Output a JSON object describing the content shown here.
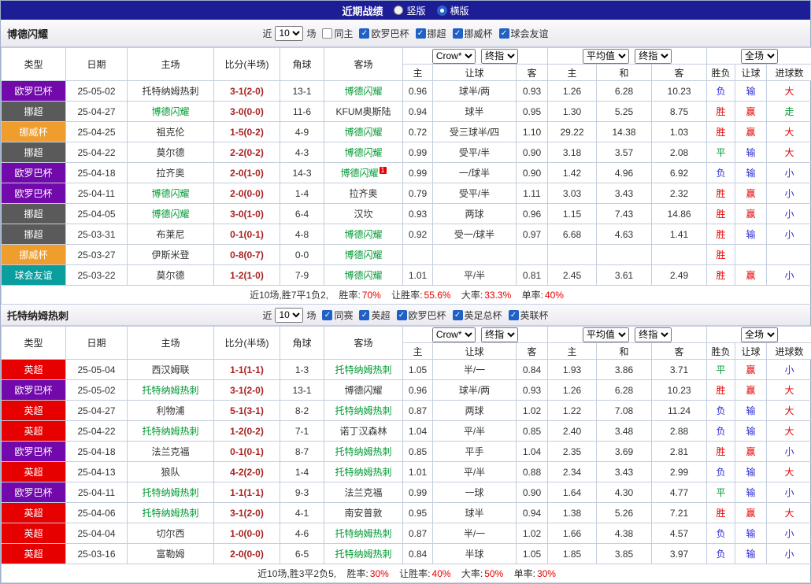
{
  "topbar": {
    "title": "近期战绩",
    "options": [
      {
        "label": "竖版",
        "selected": false
      },
      {
        "label": "横版",
        "selected": true
      }
    ]
  },
  "colors": {
    "league": {
      "欧罗巴杯": "#7109ab",
      "挪超": "#5a5a5a",
      "挪威杯": "#ef9d2c",
      "球会友谊": "#0a9e9e",
      "英超": "#e60000"
    },
    "result": {
      "胜": "#e60000",
      "平": "#009933",
      "负": "#2c2cd4",
      "赢": "#e60000",
      "走": "#009933",
      "输": "#2c2cd4",
      "大": "#e60000",
      "小": "#2c2cd4"
    }
  },
  "table_header": {
    "type": "类型",
    "date": "日期",
    "home": "主场",
    "score": "比分(半场)",
    "corner": "角球",
    "away": "客场",
    "bookmaker": "Crow*",
    "final_index_1": "终指",
    "average": "平均值",
    "final_index_2": "终指",
    "scope": "全场",
    "sub": [
      "主",
      "让球",
      "客",
      "主",
      "和",
      "客",
      "胜负",
      "让球",
      "进球数"
    ]
  },
  "sections": [
    {
      "team": "博德闪耀",
      "near_label": "近",
      "matches_value": "10",
      "matches_suffix": "场",
      "same_filter": {
        "label": "同主",
        "checked": false
      },
      "leagues": [
        {
          "label": "欧罗巴杯",
          "checked": true
        },
        {
          "label": "挪超",
          "checked": true
        },
        {
          "label": "挪威杯",
          "checked": true
        },
        {
          "label": "球会友谊",
          "checked": true
        }
      ],
      "rows": [
        {
          "league": "欧罗巴杯",
          "date": "25-05-02",
          "home": "托特纳姆热刺",
          "home_focus": false,
          "score": "3-1(2-0)",
          "corners": "13-1",
          "away": "博德闪耀",
          "away_focus": true,
          "odds": [
            "0.96",
            "球半/两",
            "0.93",
            "1.26",
            "6.28",
            "10.23"
          ],
          "results": [
            "负",
            "输",
            "大"
          ]
        },
        {
          "league": "挪超",
          "date": "25-04-27",
          "home": "博德闪耀",
          "home_focus": true,
          "score": "3-0(0-0)",
          "corners": "11-6",
          "away": "KFUM奥斯陆",
          "away_focus": false,
          "odds": [
            "0.94",
            "球半",
            "0.95",
            "1.30",
            "5.25",
            "8.75"
          ],
          "results": [
            "胜",
            "赢",
            "走"
          ]
        },
        {
          "league": "挪威杯",
          "date": "25-04-25",
          "home": "祖克伦",
          "home_focus": false,
          "score": "1-5(0-2)",
          "corners": "4-9",
          "away": "博德闪耀",
          "away_focus": true,
          "odds": [
            "0.72",
            "受三球半/四",
            "1.10",
            "29.22",
            "14.38",
            "1.03"
          ],
          "results": [
            "胜",
            "赢",
            "大"
          ]
        },
        {
          "league": "挪超",
          "date": "25-04-22",
          "home": "莫尔德",
          "home_focus": false,
          "score": "2-2(0-2)",
          "corners": "4-3",
          "away": "博德闪耀",
          "away_focus": true,
          "odds": [
            "0.99",
            "受平/半",
            "0.90",
            "3.18",
            "3.57",
            "2.08"
          ],
          "results": [
            "平",
            "输",
            "大"
          ]
        },
        {
          "league": "欧罗巴杯",
          "date": "25-04-18",
          "home": "拉齐奥",
          "home_focus": false,
          "score": "2-0(1-0)",
          "corners": "14-3",
          "away": "博德闪耀",
          "away_focus": true,
          "away_sup": "1",
          "odds": [
            "0.99",
            "一/球半",
            "0.90",
            "1.42",
            "4.96",
            "6.92"
          ],
          "results": [
            "负",
            "输",
            "小"
          ]
        },
        {
          "league": "欧罗巴杯",
          "date": "25-04-11",
          "home": "博德闪耀",
          "home_focus": true,
          "score": "2-0(0-0)",
          "corners": "1-4",
          "away": "拉齐奥",
          "away_focus": false,
          "odds": [
            "0.79",
            "受平/半",
            "1.11",
            "3.03",
            "3.43",
            "2.32"
          ],
          "results": [
            "胜",
            "赢",
            "小"
          ]
        },
        {
          "league": "挪超",
          "date": "25-04-05",
          "home": "博德闪耀",
          "home_focus": true,
          "score": "3-0(1-0)",
          "corners": "6-4",
          "away": "汉坎",
          "away_focus": false,
          "odds": [
            "0.93",
            "两球",
            "0.96",
            "1.15",
            "7.43",
            "14.86"
          ],
          "results": [
            "胜",
            "赢",
            "小"
          ]
        },
        {
          "league": "挪超",
          "date": "25-03-31",
          "home": "布莱尼",
          "home_focus": false,
          "score": "0-1(0-1)",
          "corners": "4-8",
          "away": "博德闪耀",
          "away_focus": true,
          "odds": [
            "0.92",
            "受一/球半",
            "0.97",
            "6.68",
            "4.63",
            "1.41"
          ],
          "results": [
            "胜",
            "输",
            "小"
          ]
        },
        {
          "league": "挪威杯",
          "date": "25-03-27",
          "home": "伊斯米登",
          "home_focus": false,
          "score": "0-8(0-7)",
          "corners": "0-0",
          "away": "博德闪耀",
          "away_focus": true,
          "odds": [
            "",
            "",
            "",
            "",
            "",
            ""
          ],
          "results": [
            "胜",
            "",
            ""
          ]
        },
        {
          "league": "球会友谊",
          "date": "25-03-22",
          "home": "莫尔德",
          "home_focus": false,
          "score": "1-2(1-0)",
          "corners": "7-9",
          "away": "博德闪耀",
          "away_focus": true,
          "odds": [
            "1.01",
            "平/半",
            "0.81",
            "2.45",
            "3.61",
            "2.49"
          ],
          "results": [
            "胜",
            "赢",
            "小"
          ]
        }
      ],
      "summary_lead": "近10场,胜7平1负2,",
      "summary_stats": [
        {
          "label": "胜率:",
          "value": "70%"
        },
        {
          "label": "让胜率:",
          "value": "55.6%"
        },
        {
          "label": "大率:",
          "value": "33.3%"
        },
        {
          "label": "单率:",
          "value": "40%"
        }
      ]
    },
    {
      "team": "托特纳姆热刺",
      "near_label": "近",
      "matches_value": "10",
      "matches_suffix": "场",
      "same_filter": {
        "label": "同赛",
        "checked": true
      },
      "leagues": [
        {
          "label": "英超",
          "checked": true
        },
        {
          "label": "欧罗巴杯",
          "checked": true
        },
        {
          "label": "英足总杯",
          "checked": true
        },
        {
          "label": "英联杯",
          "checked": true
        }
      ],
      "rows": [
        {
          "league": "英超",
          "date": "25-05-04",
          "home": "西汉姆联",
          "home_focus": false,
          "score": "1-1(1-1)",
          "corners": "1-3",
          "away": "托特纳姆热刺",
          "away_focus": true,
          "odds": [
            "1.05",
            "半/一",
            "0.84",
            "1.93",
            "3.86",
            "3.71"
          ],
          "results": [
            "平",
            "赢",
            "小"
          ]
        },
        {
          "league": "欧罗巴杯",
          "date": "25-05-02",
          "home": "托特纳姆热刺",
          "home_focus": true,
          "score": "3-1(2-0)",
          "corners": "13-1",
          "away": "博德闪耀",
          "away_focus": false,
          "odds": [
            "0.96",
            "球半/两",
            "0.93",
            "1.26",
            "6.28",
            "10.23"
          ],
          "results": [
            "胜",
            "赢",
            "大"
          ]
        },
        {
          "league": "英超",
          "date": "25-04-27",
          "home": "利物浦",
          "home_focus": false,
          "score": "5-1(3-1)",
          "corners": "8-2",
          "away": "托特纳姆热刺",
          "away_focus": true,
          "odds": [
            "0.87",
            "两球",
            "1.02",
            "1.22",
            "7.08",
            "11.24"
          ],
          "results": [
            "负",
            "输",
            "大"
          ]
        },
        {
          "league": "英超",
          "date": "25-04-22",
          "home": "托特纳姆热刺",
          "home_focus": true,
          "score": "1-2(0-2)",
          "corners": "7-1",
          "away": "诺丁汉森林",
          "away_focus": false,
          "odds": [
            "1.04",
            "平/半",
            "0.85",
            "2.40",
            "3.48",
            "2.88"
          ],
          "results": [
            "负",
            "输",
            "大"
          ]
        },
        {
          "league": "欧罗巴杯",
          "date": "25-04-18",
          "home": "法兰克福",
          "home_focus": false,
          "score": "0-1(0-1)",
          "corners": "8-7",
          "away": "托特纳姆热刺",
          "away_focus": true,
          "odds": [
            "0.85",
            "平手",
            "1.04",
            "2.35",
            "3.69",
            "2.81"
          ],
          "results": [
            "胜",
            "赢",
            "小"
          ]
        },
        {
          "league": "英超",
          "date": "25-04-13",
          "home": "狼队",
          "home_focus": false,
          "score": "4-2(2-0)",
          "corners": "1-4",
          "away": "托特纳姆热刺",
          "away_focus": true,
          "odds": [
            "1.01",
            "平/半",
            "0.88",
            "2.34",
            "3.43",
            "2.99"
          ],
          "results": [
            "负",
            "输",
            "大"
          ]
        },
        {
          "league": "欧罗巴杯",
          "date": "25-04-11",
          "home": "托特纳姆热刺",
          "home_focus": true,
          "score": "1-1(1-1)",
          "corners": "9-3",
          "away": "法兰克福",
          "away_focus": false,
          "odds": [
            "0.99",
            "一球",
            "0.90",
            "1.64",
            "4.30",
            "4.77"
          ],
          "results": [
            "平",
            "输",
            "小"
          ]
        },
        {
          "league": "英超",
          "date": "25-04-06",
          "home": "托特纳姆热刺",
          "home_focus": true,
          "score": "3-1(2-0)",
          "corners": "4-1",
          "away": "南安普敦",
          "away_focus": false,
          "odds": [
            "0.95",
            "球半",
            "0.94",
            "1.38",
            "5.26",
            "7.21"
          ],
          "results": [
            "胜",
            "赢",
            "大"
          ]
        },
        {
          "league": "英超",
          "date": "25-04-04",
          "home": "切尔西",
          "home_focus": false,
          "score": "1-0(0-0)",
          "corners": "4-6",
          "away": "托特纳姆热刺",
          "away_focus": true,
          "odds": [
            "0.87",
            "半/一",
            "1.02",
            "1.66",
            "4.38",
            "4.57"
          ],
          "results": [
            "负",
            "输",
            "小"
          ]
        },
        {
          "league": "英超",
          "date": "25-03-16",
          "home": "富勒姆",
          "home_focus": false,
          "score": "2-0(0-0)",
          "corners": "6-5",
          "away": "托特纳姆热刺",
          "away_focus": true,
          "odds": [
            "0.84",
            "半球",
            "1.05",
            "1.85",
            "3.85",
            "3.97"
          ],
          "results": [
            "负",
            "输",
            "小"
          ]
        }
      ],
      "summary_lead": "近10场,胜3平2负5,",
      "summary_stats": [
        {
          "label": "胜率:",
          "value": "30%"
        },
        {
          "label": "让胜率:",
          "value": "40%"
        },
        {
          "label": "大率:",
          "value": "50%"
        },
        {
          "label": "单率:",
          "value": "30%"
        }
      ]
    }
  ]
}
